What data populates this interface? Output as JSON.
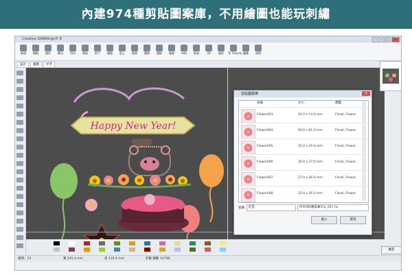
{
  "banner": {
    "title": "內建974種剪貼圖案庫，不用繪圖也能玩刺繡",
    "color": "#2f6f7a"
  },
  "app": {
    "title": "Creative DRAWings® 8"
  },
  "ribbon": {
    "buttons": [
      {
        "icon": "new-icon",
        "label": "新增"
      },
      {
        "icon": "open-icon",
        "label": "開啟"
      },
      {
        "icon": "save-icon",
        "label": "儲存"
      },
      {
        "icon": "export-icon",
        "label": "匯出"
      },
      {
        "icon": "print-icon",
        "label": "列印"
      },
      {
        "icon": "send-icon",
        "label": "傳送"
      },
      {
        "icon": "cut-icon",
        "label": "剪下"
      },
      {
        "icon": "copy-icon",
        "label": "複製"
      },
      {
        "icon": "paste-icon",
        "label": "貼上"
      },
      {
        "icon": "undo-icon",
        "label": "復原"
      },
      {
        "icon": "redo-icon",
        "label": "重做"
      },
      {
        "icon": "select-icon",
        "label": "選取"
      },
      {
        "icon": "zoom-icon",
        "label": "縮放"
      },
      {
        "icon": "fabric-icon",
        "label": "布料"
      },
      {
        "icon": "hoop-icon",
        "label": "框架"
      },
      {
        "icon": "3d-icon",
        "label": "3D"
      },
      {
        "icon": "transform-icon",
        "label": "變形"
      },
      {
        "icon": "tutor-icon",
        "label": "To Tutorial"
      },
      {
        "icon": "library-icon",
        "label": "圖庫"
      },
      {
        "icon": "help-icon",
        "label": "說明"
      }
    ]
  },
  "tabs": [
    {
      "label": "設計"
    },
    {
      "label": "繪圖"
    },
    {
      "label": "文字"
    }
  ],
  "canvas": {
    "artwork_text": "Happy New Year!"
  },
  "dialog": {
    "title": "剪貼圖案庫",
    "columns": [
      "名稱",
      "大小",
      "標籤"
    ],
    "rows": [
      {
        "name": "Flower003",
        "size": "14.0 x 14.0 mm",
        "tags": "Floral, Flower"
      },
      {
        "name": "Flower004",
        "size": "60.0 x 61.0 mm",
        "tags": "Floral, Flower"
      },
      {
        "name": "Flower005",
        "size": "25.0 x 25.0 mm",
        "tags": "Floral, Flower"
      },
      {
        "name": "Flower006",
        "size": "28.0 x 27.0 mm",
        "tags": "Floral, Flower"
      },
      {
        "name": "Flower007",
        "size": "27.0 x 26.0 mm",
        "tags": "Floral, Flower"
      },
      {
        "name": "Flower008",
        "size": "25.0 x 26.0 mm",
        "tags": "Floral, Flower"
      }
    ],
    "name_label": "名稱",
    "name_value": "紅花",
    "path_value": "MTAINS圖案庫\\Fla_02C.hx",
    "insert_button": "插入",
    "cancel_button": "取消"
  },
  "ok_button": "確定",
  "status": {
    "left": "選項：23",
    "size": "寬 245.4 mm",
    "height": "高 139.0 mm",
    "stitches": "針數 總數 14798"
  },
  "palette_colors": [
    "#000000",
    "#ffffff",
    "#9c2d2d",
    "#6b6b6b",
    "#6b8e23",
    "#c9a227",
    "#3b6ea5",
    "#d46aa0",
    "#e5d5a1",
    "#2e8b57",
    "#a0522d",
    "#f0e68c",
    "#c0c0c0",
    "#7b3f61",
    "#ff8c00",
    "#9acd32",
    "#4682b4",
    "#d2b48c",
    "#8b0000",
    "#daa520",
    "#b0c4de",
    "#556b2f",
    "#cd5c5c",
    "#87cefa"
  ]
}
